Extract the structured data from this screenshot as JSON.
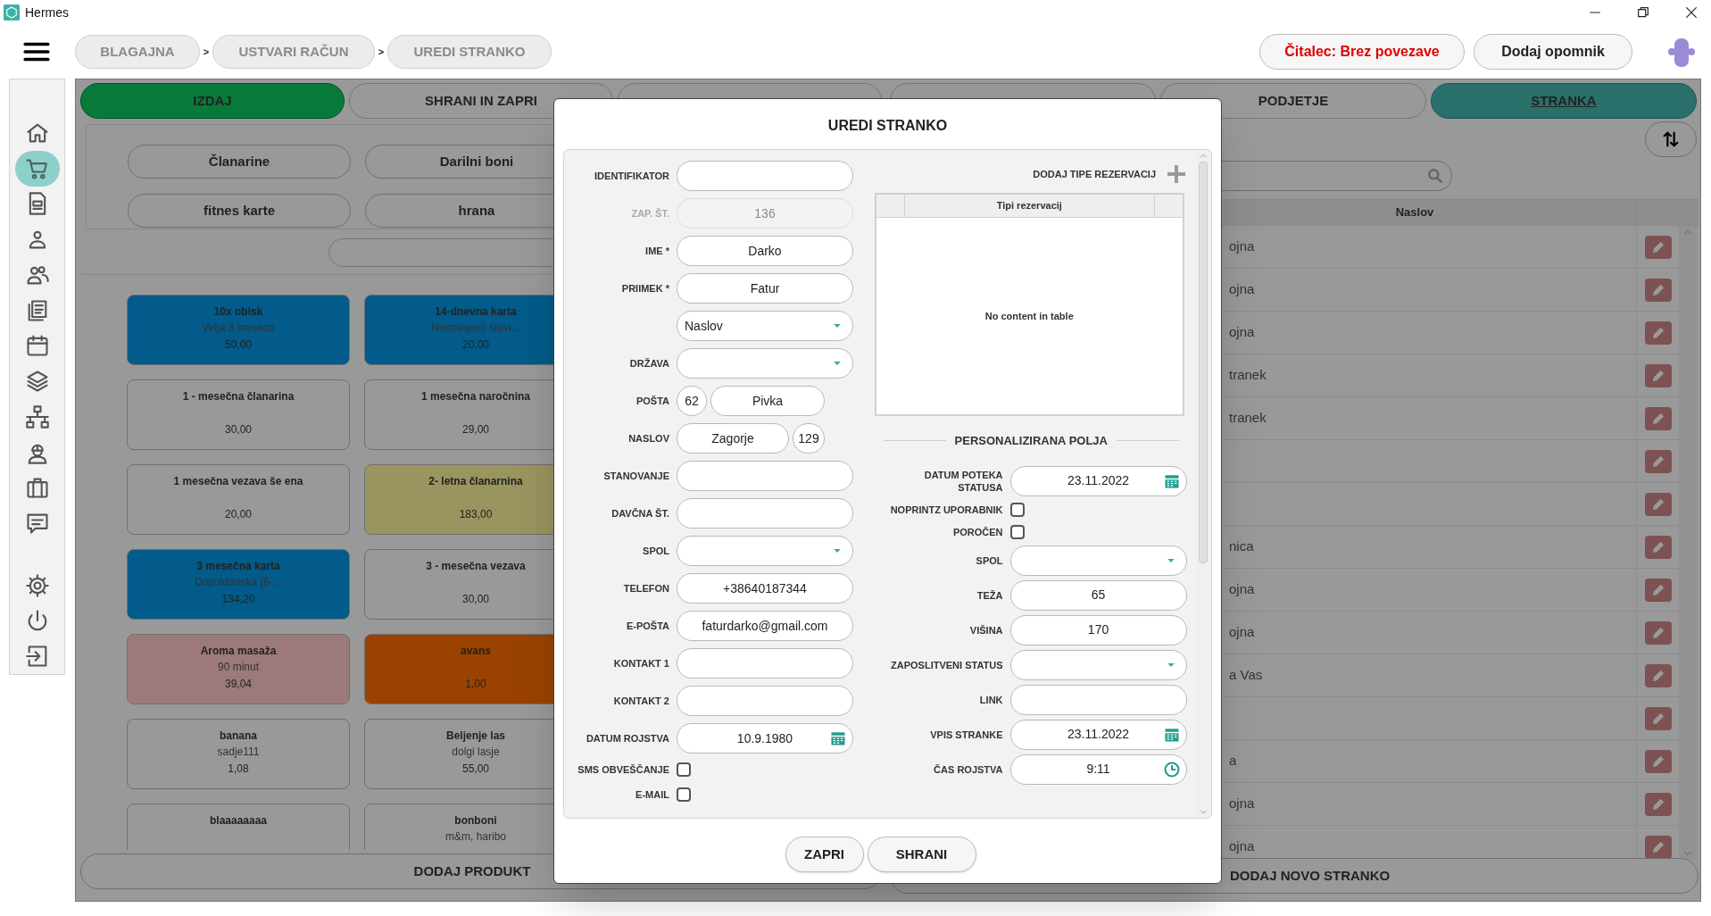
{
  "window": {
    "title": "Hermes"
  },
  "breadcrumbs": [
    {
      "label": "BLAGAJNA"
    },
    {
      "label": "USTVARI RAČUN"
    },
    {
      "label": "UREDI STRANKO"
    }
  ],
  "breadcrumb_separators": [
    ">",
    ">"
  ],
  "header_buttons": [
    {
      "label": "Čitalec: Brez povezave",
      "kind": "alert"
    },
    {
      "label": "Dodaj opomnik",
      "kind": "normal"
    }
  ],
  "sidebar": {
    "items": [
      {
        "kind": "home",
        "selected": false
      },
      {
        "kind": "cart",
        "selected": true
      },
      {
        "kind": "document",
        "selected": false
      },
      {
        "kind": "person",
        "selected": false
      },
      {
        "kind": "people",
        "selected": false
      },
      {
        "kind": "documents",
        "selected": false
      },
      {
        "kind": "calendar",
        "selected": false
      },
      {
        "kind": "layers",
        "selected": false
      },
      {
        "kind": "network",
        "selected": false
      },
      {
        "kind": "worker",
        "selected": false
      },
      {
        "kind": "briefcase",
        "selected": false
      },
      {
        "kind": "chat",
        "selected": false
      },
      {
        "kind": "settings",
        "selected": false
      },
      {
        "kind": "power",
        "selected": false
      },
      {
        "kind": "logout",
        "selected": false
      }
    ]
  },
  "left_panel": {
    "tabs": [
      {
        "label": "IZDAJ",
        "selected": true
      },
      {
        "label": "SHRANI IN ZAPRI",
        "selected": false
      },
      {
        "selected": false
      }
    ],
    "categories": [
      "Članarine",
      "Darilni boni",
      "fitnes karte",
      "hrana"
    ],
    "products": [
      {
        "name": "10x obisk",
        "description": "Velja 3 mesece",
        "price": "50,00",
        "color": "#025b8a"
      },
      {
        "name": "14-dnevna karta",
        "description": "Neomejeno števi...",
        "price": "20,00",
        "color": "#025b8a"
      },
      {
        "name": "1 - mesečna članarina",
        "price": "30,00",
        "color": "#999999"
      },
      {
        "name": "1 mesečna naročnina",
        "price": "29,00",
        "color": "#999999"
      },
      {
        "name": "1 mesečna vezava še ena",
        "price": "20,00",
        "color": "#999999"
      },
      {
        "name": "2- letna članarnina",
        "price": "183,00",
        "color": "#9a945f"
      },
      {
        "name": "3 mesečna karta",
        "description": "Dopoldanska (6-...",
        "price": "134,20",
        "color": "#025b8a"
      },
      {
        "name": "3 - mesečna vezava",
        "price": "30,00",
        "color": "#999999"
      },
      {
        "name": "Aroma masaža",
        "description": "90 minut",
        "price": "39,04",
        "color": "#9c7a7c"
      },
      {
        "name": "avans",
        "price": "1,00",
        "color": "#9a4300"
      },
      {
        "name": "banana",
        "description": "sadje111",
        "price": "1,08",
        "color": "#999999"
      },
      {
        "name": "Beljenje las",
        "description": "dolgi lasje",
        "price": "55,00",
        "color": "#999999"
      },
      {
        "name": "blaaaaaaaa",
        "color": "#999999"
      },
      {
        "name": "bonboni",
        "description": "m&m, haribo",
        "color": "#999999"
      }
    ],
    "add_button": "DODAJ PRODUKT"
  },
  "right_panel": {
    "tabs": [
      {
        "selected": false
      },
      {
        "label": "PODJETJE",
        "selected": false
      },
      {
        "label": "STRANKA",
        "selected": true
      }
    ],
    "table": {
      "columns": [
        "Naslov"
      ],
      "rows": [
        {
          "naslov": "ojna"
        },
        {
          "naslov": "ojna"
        },
        {
          "naslov": "ojna"
        },
        {
          "naslov": "tranek"
        },
        {
          "naslov": "tranek"
        },
        {},
        {},
        {
          "naslov": "nica"
        },
        {
          "naslov": "ojna"
        },
        {
          "naslov": "ojna"
        },
        {
          "naslov": "a Vas"
        },
        {},
        {
          "naslov": "a"
        },
        {
          "naslov": "ojna"
        },
        {
          "naslov": "ojna"
        }
      ]
    },
    "add_button": "DODAJ NOVO STRANKO"
  },
  "dialog": {
    "title": "UREDI STRANKO",
    "fields": [
      {
        "kind": "text",
        "label": "IDENTIFIKATOR",
        "disabled": false
      },
      {
        "kind": "text",
        "label": "ZAP. ŠT.",
        "value": "136",
        "disabled": true
      },
      {
        "kind": "text",
        "label": "IME *",
        "value": "Darko",
        "disabled": false
      },
      {
        "kind": "text",
        "label": "PRIIMEK *",
        "value": "Fatur",
        "disabled": false
      },
      {
        "kind": "dropdown",
        "value": "Naslov",
        "disabled": false
      },
      {
        "kind": "dropdown",
        "label": "DRŽAVA",
        "disabled": false
      },
      {
        "kind": "postal",
        "label": "POŠTA",
        "values": [
          "62",
          "Pivka"
        ],
        "disabled": false
      },
      {
        "kind": "street",
        "label": "NASLOV",
        "values": [
          "Zagorje",
          "129"
        ],
        "disabled": false
      },
      {
        "kind": "text",
        "label": "STANOVANJE",
        "disabled": false
      },
      {
        "kind": "text",
        "label": "DAVČNA ŠT.",
        "disabled": false
      },
      {
        "kind": "dropdown",
        "label": "SPOL",
        "disabled": false
      },
      {
        "kind": "text",
        "label": "TELEFON",
        "value": "+38640187344",
        "disabled": false
      },
      {
        "kind": "text",
        "label": "E-POŠTA",
        "value": "faturdarko@gmail.com",
        "disabled": false
      },
      {
        "kind": "text",
        "label": "KONTAKT 1",
        "disabled": false
      },
      {
        "kind": "text",
        "label": "KONTAKT 2",
        "disabled": false
      },
      {
        "kind": "date",
        "label": "DATUM ROJSTVA",
        "value": "10.9.1980",
        "disabled": false
      },
      {
        "kind": "checkbox",
        "label": "SMS OBVEŠČANJE",
        "checked": false,
        "disabled": false
      },
      {
        "kind": "checkbox",
        "label": "E-MAIL",
        "checked": false,
        "disabled": false
      }
    ],
    "reservations": {
      "label": "DODAJ TIPE REZERVACIJ",
      "column": "Tipi rezervacij",
      "empty_text": "No content in table"
    },
    "section_title": "PERSONALIZIRANA POLJA",
    "custom_fields": [
      {
        "kind": "date",
        "label": "DATUM POTEKA STATUSA",
        "value": "23.11.2022"
      },
      {
        "kind": "checkbox",
        "label": "NOPRINTZ UPORABNIK",
        "checked": false
      },
      {
        "kind": "checkbox",
        "label": "POROČEN",
        "checked": false
      },
      {
        "kind": "dropdown",
        "label": "SPOL"
      },
      {
        "kind": "text",
        "label": "TEŽA",
        "value": "65"
      },
      {
        "kind": "text",
        "label": "VIŠINA",
        "value": "170"
      },
      {
        "kind": "dropdown",
        "label": "ZAPOSLITVENI STATUS"
      },
      {
        "kind": "text",
        "label": "LINK"
      },
      {
        "kind": "date",
        "label": "VPIS STRANKE",
        "value": "23.11.2022"
      },
      {
        "kind": "time",
        "label": "ČAS ROJSTVA",
        "value": "9:11"
      }
    ],
    "buttons": [
      "ZAPRI",
      "SHRANI"
    ]
  }
}
